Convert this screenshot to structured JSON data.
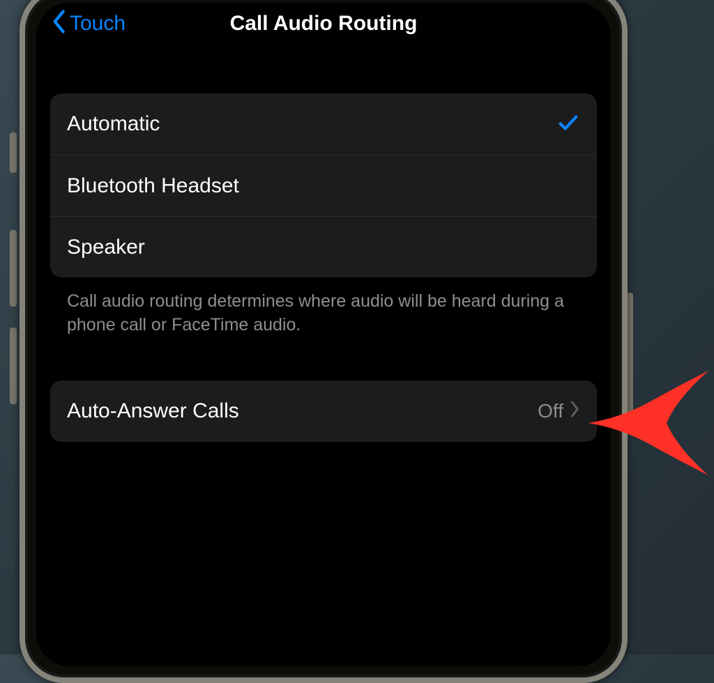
{
  "nav": {
    "back_label": "Touch",
    "title": "Call Audio Routing"
  },
  "routing_options": {
    "items": [
      {
        "label": "Automatic",
        "selected": true
      },
      {
        "label": "Bluetooth Headset",
        "selected": false
      },
      {
        "label": "Speaker",
        "selected": false
      }
    ],
    "footer": "Call audio routing determines where audio will be heard during a phone call or FaceTime audio."
  },
  "auto_answer": {
    "label": "Auto-Answer Calls",
    "value": "Off"
  },
  "colors": {
    "accent": "#0a84ff",
    "annotation": "#ff3b30"
  }
}
